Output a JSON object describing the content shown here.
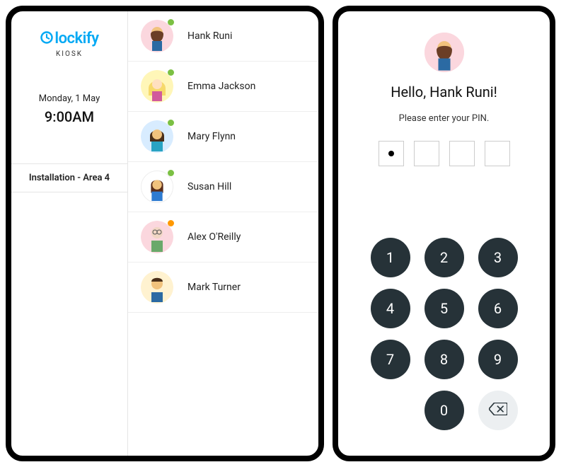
{
  "left": {
    "logo_word": "lockify",
    "logo_sub": "KIOSK",
    "date": "Monday, 1 May",
    "time": "9:00AM",
    "location": "Installation - Area 4",
    "people": [
      {
        "name": "Hank Runi",
        "bg": "#fbd7de",
        "status": "green"
      },
      {
        "name": "Emma Jackson",
        "bg": "#fff6b8",
        "status": "green"
      },
      {
        "name": "Mary Flynn",
        "bg": "#d8ecff",
        "status": "green"
      },
      {
        "name": "Susan Hill",
        "bg": "#ffffff",
        "status": "green"
      },
      {
        "name": "Alex O'Reilly",
        "bg": "#fbd7de",
        "status": "orange"
      },
      {
        "name": "Mark Turner",
        "bg": "#fff2d0",
        "status": "none"
      }
    ]
  },
  "right": {
    "greeting": "Hello, Hank Runi!",
    "prompt": "Please enter your PIN.",
    "pin_entered_count": 1,
    "pin_length": 4,
    "keys": [
      "1",
      "2",
      "3",
      "4",
      "5",
      "6",
      "7",
      "8",
      "9",
      "0"
    ]
  }
}
